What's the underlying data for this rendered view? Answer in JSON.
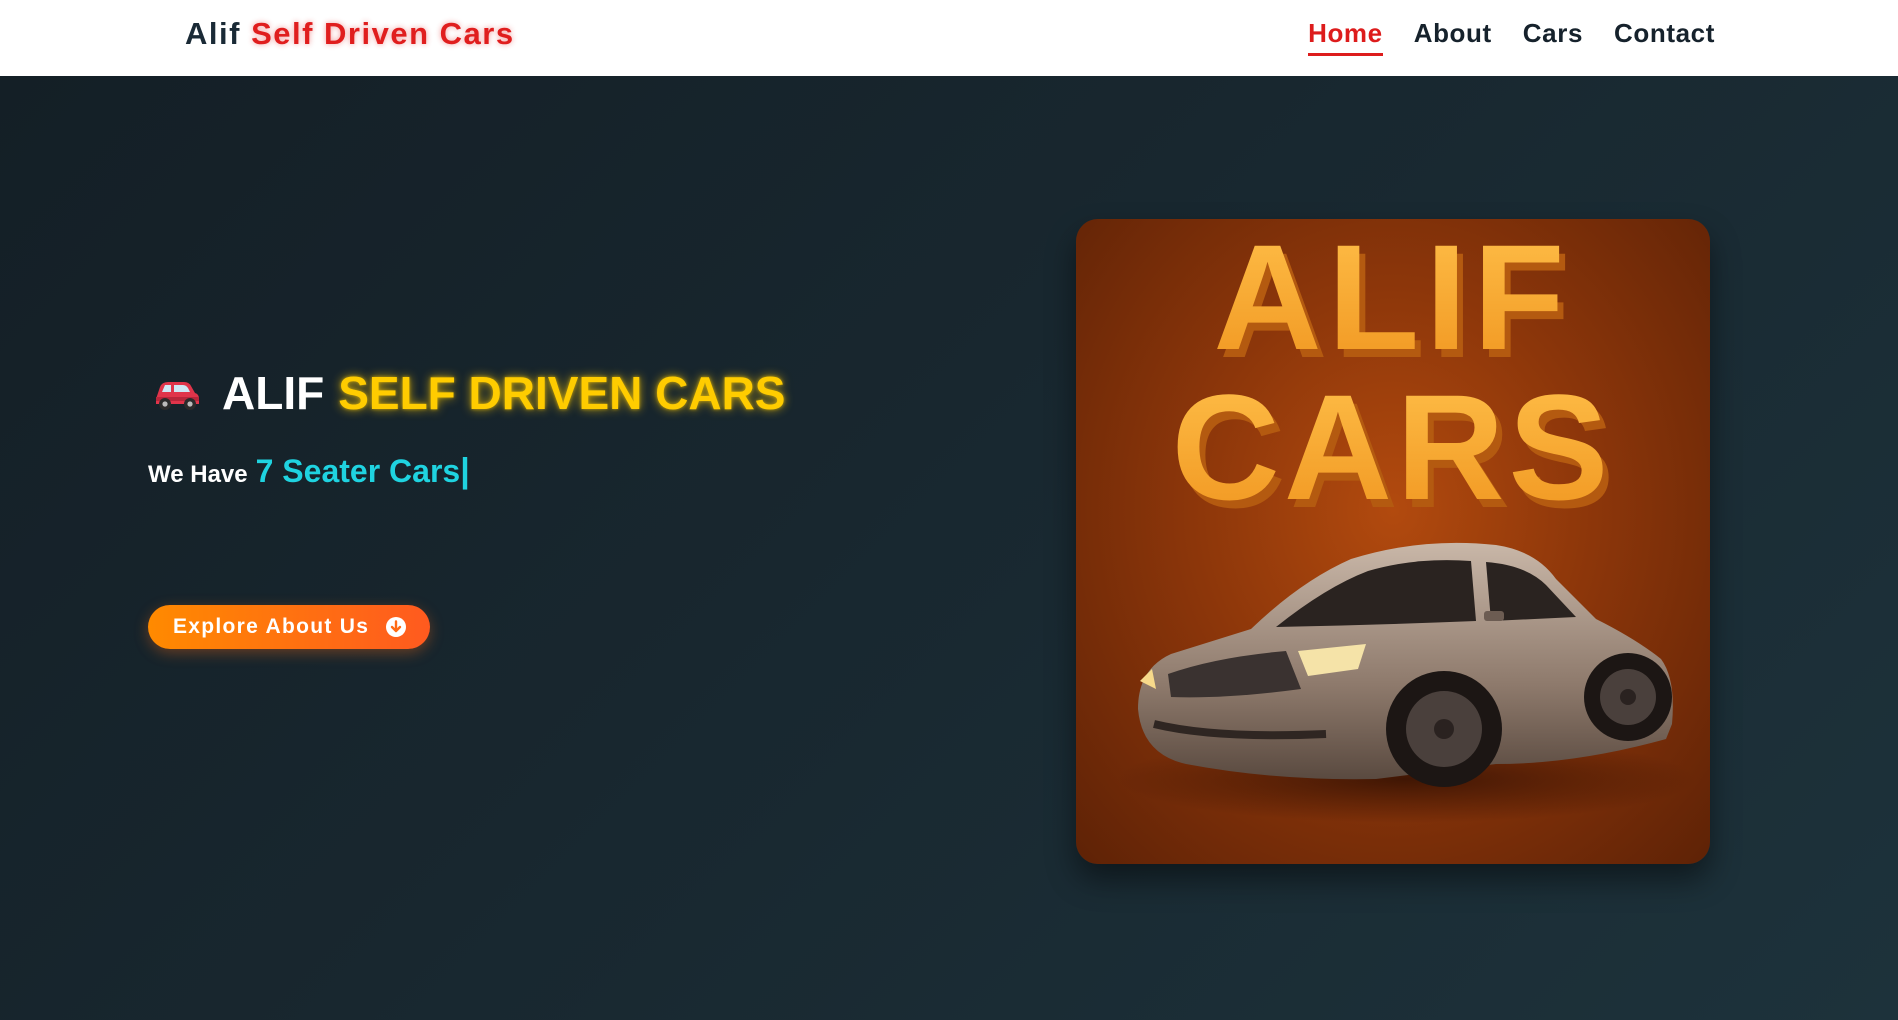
{
  "navbar": {
    "brand_plain": "Alif",
    "brand_accent": "Self Driven Cars",
    "links": [
      {
        "label": "Home",
        "active": true
      },
      {
        "label": "About",
        "active": false
      },
      {
        "label": "Cars",
        "active": false
      },
      {
        "label": "Contact",
        "active": false
      }
    ]
  },
  "hero": {
    "headline_icon": "red-car-emoji-icon",
    "headline_plain": "ALIF",
    "headline_accent": "SELF DRIVEN CARS",
    "subline_prefix": "We Have",
    "subline_typed": "7 Seater Cars",
    "subline_cursor": "|",
    "cta_label": "Explore About Us",
    "cta_icon": "arrow-down-circle-icon"
  },
  "promo_image": {
    "line1": "ALIF",
    "line2": "CARS"
  },
  "colors": {
    "accent_red": "#e01e1e",
    "headline_gold": "#ffcc00",
    "typed_cyan": "#1fd3e0",
    "cta_orange": "#ff7a10",
    "hero_bg": "#18272f"
  }
}
